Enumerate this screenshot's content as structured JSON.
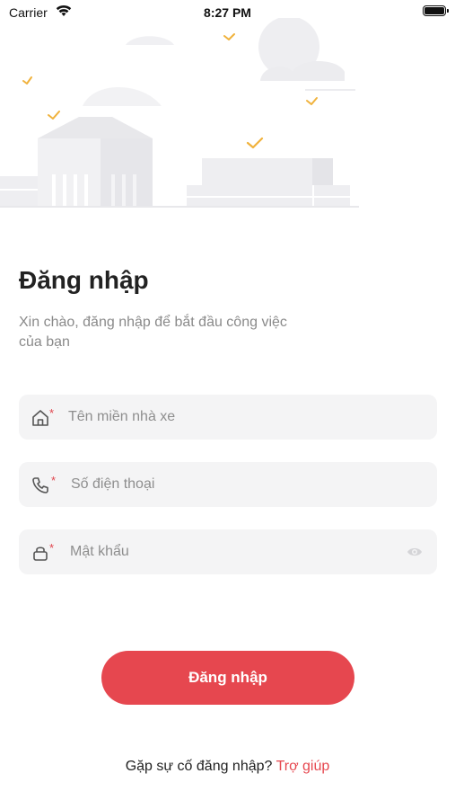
{
  "status_bar": {
    "carrier": "Carrier",
    "time": "8:27 PM"
  },
  "login": {
    "title": "Đăng nhập",
    "subtitle": "Xin chào, đăng nhập để bắt đầu công việc của bạn",
    "fields": {
      "domain": {
        "placeholder": "Tên miền nhà xe",
        "icon": "home-icon",
        "required": "*"
      },
      "phone": {
        "placeholder": "Số điện thoại",
        "icon": "phone-icon",
        "required": "*"
      },
      "password": {
        "placeholder": "Mật khẩu",
        "icon": "lock-icon",
        "required": "*",
        "toggle_icon": "eye-icon"
      }
    },
    "submit_label": "Đăng nhập",
    "help_text": "Gặp sự cố đăng nhập?",
    "help_link": "Trợ giúp"
  },
  "colors": {
    "accent": "#e6474f",
    "field_bg": "#f4f4f5",
    "muted_text": "#8a8a8a"
  }
}
